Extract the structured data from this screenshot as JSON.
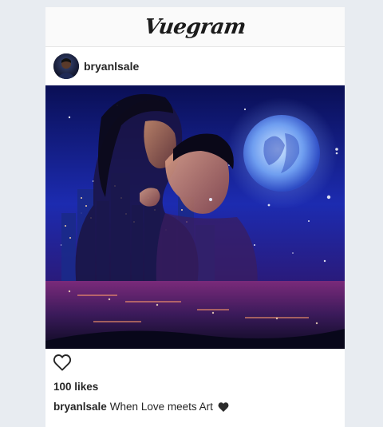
{
  "header": {
    "title": "Vuegram"
  },
  "post": {
    "username": "bryanlsale",
    "likes_text": "100 likes",
    "caption_user": "bryanlsale",
    "caption_text": "When Love meets Art",
    "caption_emoji": "black-heart-icon"
  },
  "icons": {
    "like": "heart-outline-icon"
  },
  "colors": {
    "background": "#e8ecf1",
    "text": "#262626"
  }
}
